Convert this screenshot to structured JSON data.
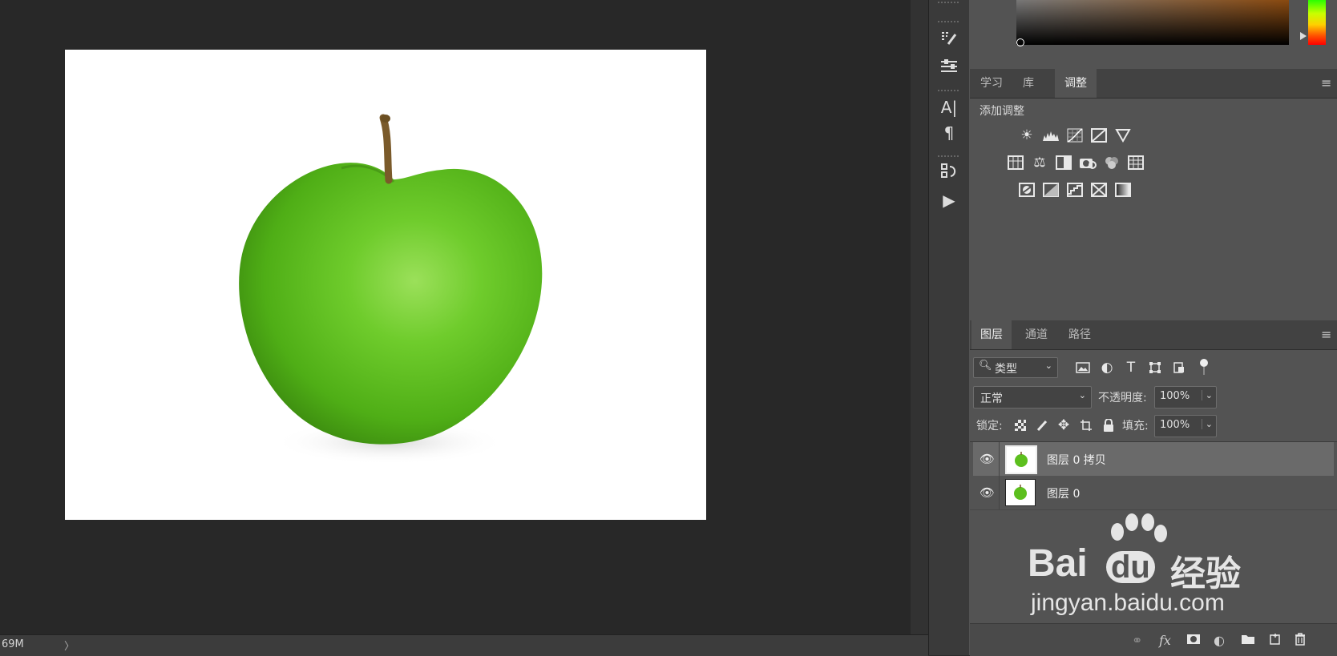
{
  "status": {
    "zoom": "69M",
    "arrow": "〉"
  },
  "tools": {
    "brush_settings": "brush-settings-icon",
    "properties": "properties-icon",
    "character": "A|",
    "paragraph": "¶",
    "history": "history-icon",
    "actions": "▶"
  },
  "adjust_panel": {
    "tabs": [
      "学习",
      "库",
      "调整"
    ],
    "active_tab": "调整",
    "title": "添加调整",
    "icons_row1": [
      "brightness-icon",
      "levels-icon",
      "curves-icon",
      "exposure-icon",
      "vibrance-icon"
    ],
    "icons_row2": [
      "hue-saturation-icon",
      "color-balance-icon",
      "black-white-icon",
      "photo-filter-icon",
      "channel-mixer-icon",
      "color-lookup-icon"
    ],
    "icons_row3": [
      "invert-icon",
      "posterize-icon",
      "threshold-icon",
      "selective-color-icon",
      "gradient-map-icon"
    ]
  },
  "layers_panel": {
    "tabs": [
      "图层",
      "通道",
      "路径"
    ],
    "active_tab": "图层",
    "filter_value": "类型",
    "blend_mode": "正常",
    "opacity_label": "不透明度:",
    "opacity_value": "100%",
    "lock_label": "锁定:",
    "fill_label": "填充:",
    "fill_value": "100%",
    "layers": [
      {
        "name": "图层 0 拷贝",
        "selected": true
      },
      {
        "name": "图层 0",
        "selected": false
      }
    ]
  },
  "watermark": {
    "brand": "Bai",
    "brand2": "du",
    "cn": "经验",
    "url": "jingyan.baidu.com"
  },
  "colors": {
    "accent_green": "#5cbf1e",
    "panel_bg": "#535353",
    "canvas_bg": "#282828"
  }
}
